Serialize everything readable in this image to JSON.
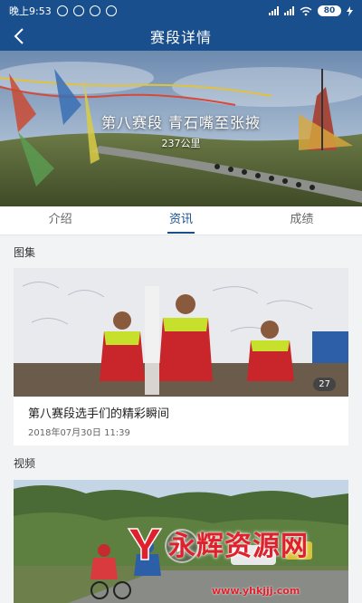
{
  "status": {
    "time": "晚上9:53",
    "battery": "80"
  },
  "nav": {
    "title": "赛段详情"
  },
  "hero": {
    "title": "第八赛段 青石嘴至张掖",
    "distance": "237公里"
  },
  "tabs": [
    {
      "label": "介绍"
    },
    {
      "label": "资讯"
    },
    {
      "label": "成绩"
    }
  ],
  "active_tab": "资讯",
  "gallery": {
    "section_label": "图集",
    "caption": "第八赛段选手们的精彩瞬间",
    "date": "2018年07月30日  11:39",
    "count": "27"
  },
  "video": {
    "section_label": "视频"
  },
  "watermark": {
    "text": "永辉资源网",
    "url": "www.yhkjjj.com"
  },
  "colors": {
    "primary": "#1a4f8d",
    "watermark": "#e0202c"
  }
}
